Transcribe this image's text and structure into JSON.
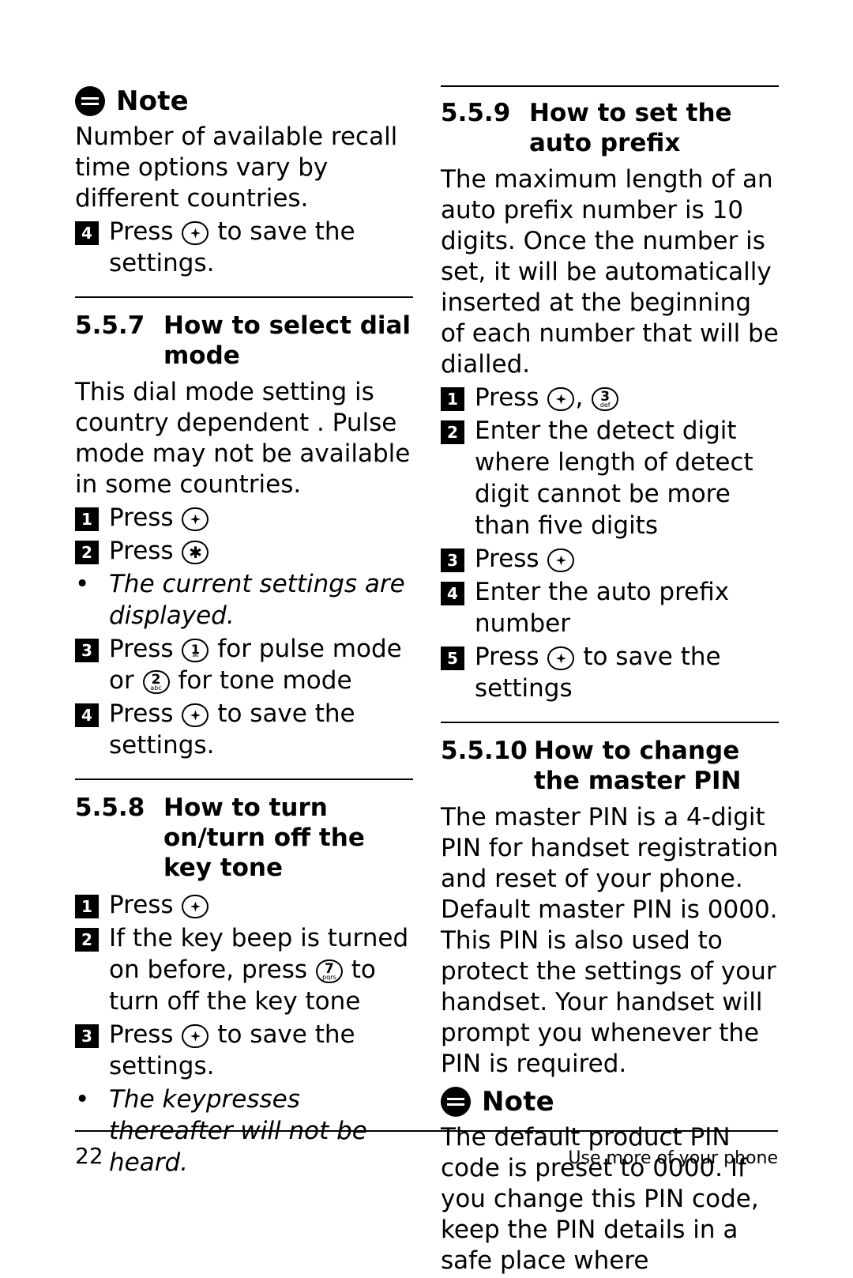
{
  "page": {
    "number": "22",
    "footer_right": "Use more of your phone"
  },
  "left": {
    "note": {
      "title": "Note",
      "text": "Number of available recall time options vary by different countries."
    },
    "note_step": {
      "num": "4",
      "pre": "Press",
      "post": "to save the settings."
    },
    "section_557": {
      "number": "5.5.7",
      "title": "How to select dial mode",
      "body": "This dial mode setting is country dependent . Pulse mode may not be available in some countries.",
      "steps": [
        {
          "num": "1",
          "pre": "Press",
          "post": ""
        },
        {
          "num": "2",
          "pre": "Press",
          "post": ""
        }
      ],
      "bullet": "The current settings are displayed.",
      "step3": {
        "num": "3",
        "pre": "Press",
        "mid": "for pulse mode",
        "or": "or",
        "post": "for tone mode"
      },
      "step4": {
        "num": "4",
        "pre": "Press",
        "post": "to save the settings."
      }
    },
    "section_558": {
      "number": "5.5.8",
      "title": "How to turn on/turn off the key tone",
      "step1": {
        "num": "1",
        "pre": "Press"
      },
      "step2": {
        "num": "2",
        "pre": "If the key beep is turned on before, press",
        "post": "to turn off the key tone"
      },
      "step3": {
        "num": "3",
        "pre": "Press",
        "post": "to save the settings."
      },
      "bullet": "The keypresses thereafter will not be heard."
    }
  },
  "right": {
    "section_559": {
      "number": "5.5.9",
      "title": "How to set the auto prefix",
      "body": "The maximum length of an auto prefix number is 10 digits. Once the number is set, it will be automatically inserted at the beginning of each number that will be dialled.",
      "step1": {
        "num": "1",
        "pre": "Press",
        "comma": ",",
        "post": ""
      },
      "step2": {
        "num": "2",
        "text": "Enter the detect digit where length of detect digit cannot be more than five digits"
      },
      "step3": {
        "num": "3",
        "pre": "Press",
        "post": ""
      },
      "step4": {
        "num": "4",
        "text": "Enter the auto prefix number"
      },
      "step5": {
        "num": "5",
        "pre": "Press",
        "post": "to save the settings"
      }
    },
    "section_5510": {
      "number": "5.5.10",
      "title": "How to change the master PIN",
      "body": "The master PIN is a 4-digit PIN for handset registration and reset of your phone. Default master PIN is 0000. This PIN is also used to protect the settings of your handset. Your handset will prompt you whenever the PIN is required.",
      "note": {
        "title": "Note",
        "text": "The default product PIN code is preset to 0000. If you change this PIN code, keep the PIN details in a safe place where"
      }
    }
  },
  "keys": {
    "menu": "menu-key",
    "star": "star-key",
    "one": {
      "digit": "1",
      "label": "✉"
    },
    "two": {
      "digit": "2",
      "label": "abc"
    },
    "three": {
      "digit": "3",
      "label": "def"
    },
    "seven": {
      "digit": "7",
      "label": "pqrs"
    }
  }
}
